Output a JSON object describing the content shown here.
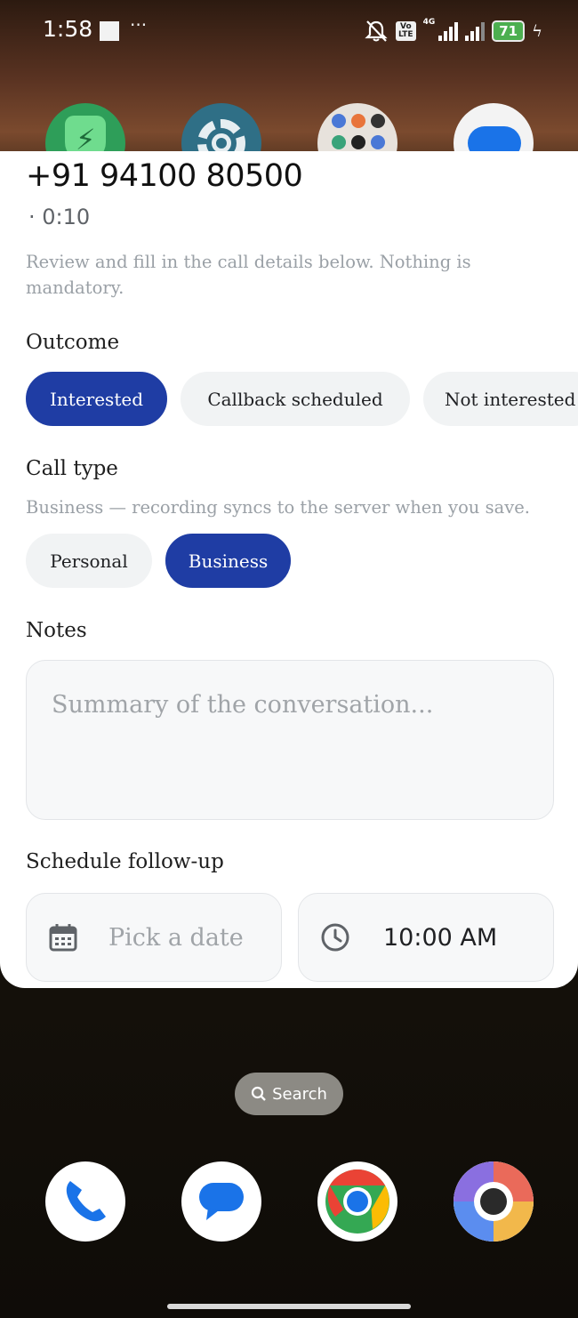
{
  "status_bar": {
    "time": "1:58",
    "more": "···",
    "volte": "Vo LTE",
    "network": "4G",
    "battery": "71"
  },
  "sheet": {
    "phone_number": "+91 94100 80500",
    "duration": "· 0:10",
    "intro": "Review and fill in the call details below. Nothing is mandatory.",
    "outcome": {
      "title": "Outcome",
      "options": [
        "Interested",
        "Callback scheduled",
        "Not interested"
      ],
      "selected": "Interested"
    },
    "call_type": {
      "title": "Call type",
      "subtitle": "Business — recording syncs to the server when you save.",
      "options": [
        "Personal",
        "Business"
      ],
      "selected": "Business"
    },
    "notes": {
      "title": "Notes",
      "placeholder": "Summary of the conversation..."
    },
    "follow_up": {
      "title": "Schedule follow-up",
      "date_placeholder": "Pick a date",
      "time_value": "10:00 AM"
    }
  },
  "home": {
    "search_label": "Search",
    "top_icons": [
      "power-shield-icon",
      "settings-icon",
      "app-folder-icon",
      "messages-icon"
    ],
    "dock_icons": [
      "phone-icon",
      "messages-icon",
      "chrome-icon",
      "camera-icon"
    ]
  },
  "colors": {
    "accent": "#1f3da4",
    "chip_inactive": "#f1f3f4",
    "muted_text": "#9aa0a6"
  }
}
